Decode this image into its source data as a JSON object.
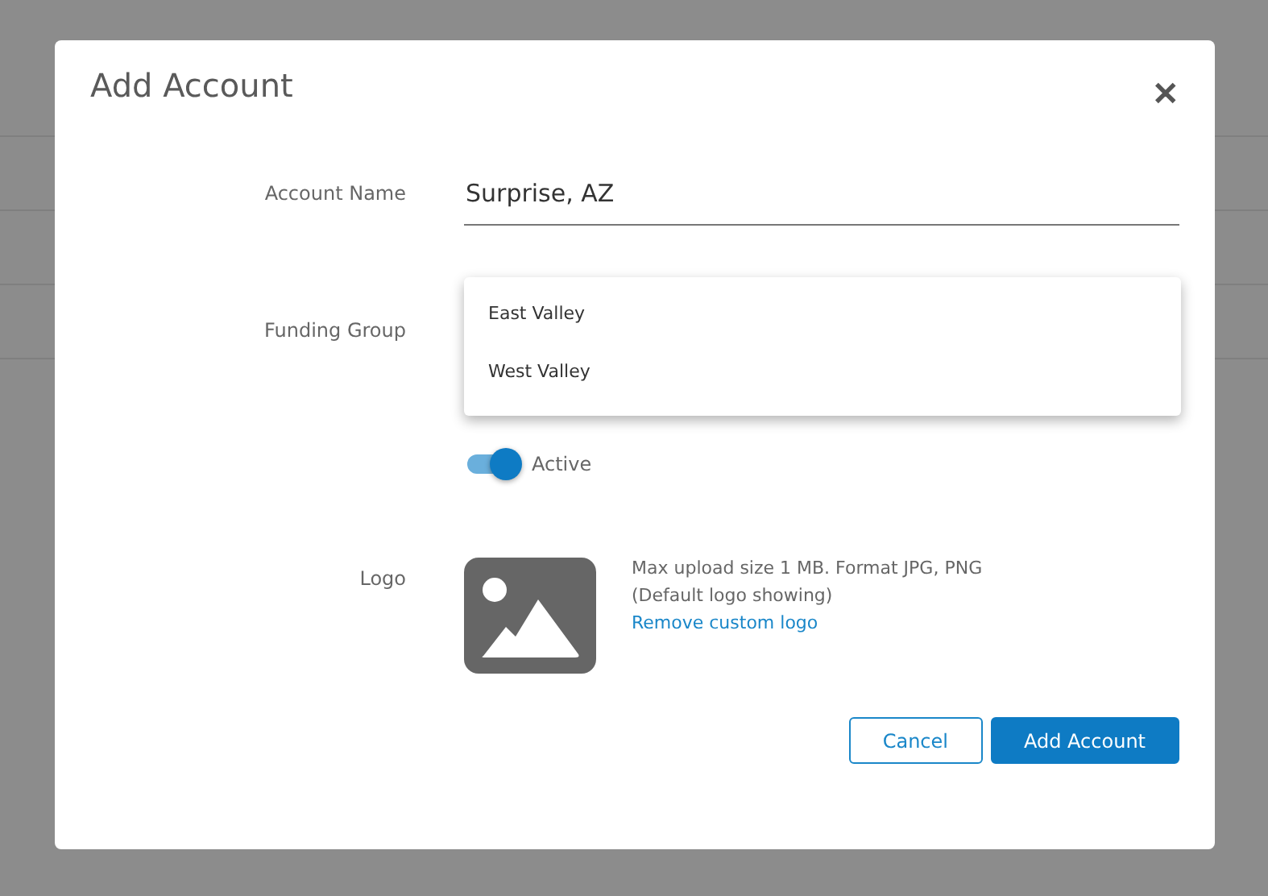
{
  "dialog": {
    "title": "Add Account",
    "close": "✕"
  },
  "account_name": {
    "label": "Account Name",
    "value": "Surprise, AZ"
  },
  "funding_group": {
    "label": "Funding Group",
    "options": [
      {
        "label": "East Valley"
      },
      {
        "label": "West Valley"
      }
    ]
  },
  "active": {
    "label": "Active",
    "on": true
  },
  "logo": {
    "label": "Logo",
    "hint": "Max upload size 1 MB. Format JPG, PNG",
    "status": "(Default logo showing)",
    "remove_link": "Remove custom logo"
  },
  "buttons": [
    {
      "label": "Cancel",
      "kind": "secondary"
    },
    {
      "label": "Add Account",
      "kind": "primary"
    }
  ]
}
